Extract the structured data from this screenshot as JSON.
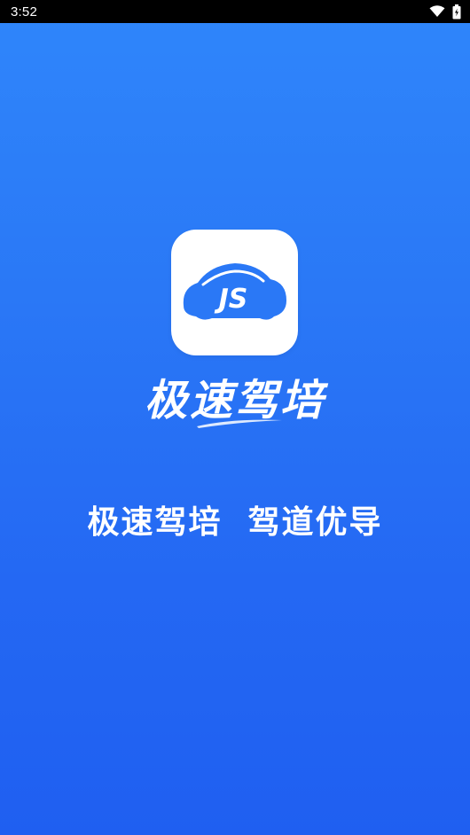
{
  "status_bar": {
    "time": "3:52",
    "icons": [
      "wifi-icon",
      "battery-icon"
    ]
  },
  "splash": {
    "logo_text": "JS",
    "app_name": "极速驾培",
    "slogan": "极速驾培  驾道优导"
  },
  "colors": {
    "background_top": "#2f86fb",
    "background_bottom": "#1f5ff1",
    "logo_car": "#2a78f6",
    "card": "#ffffff",
    "text": "#ffffff"
  }
}
